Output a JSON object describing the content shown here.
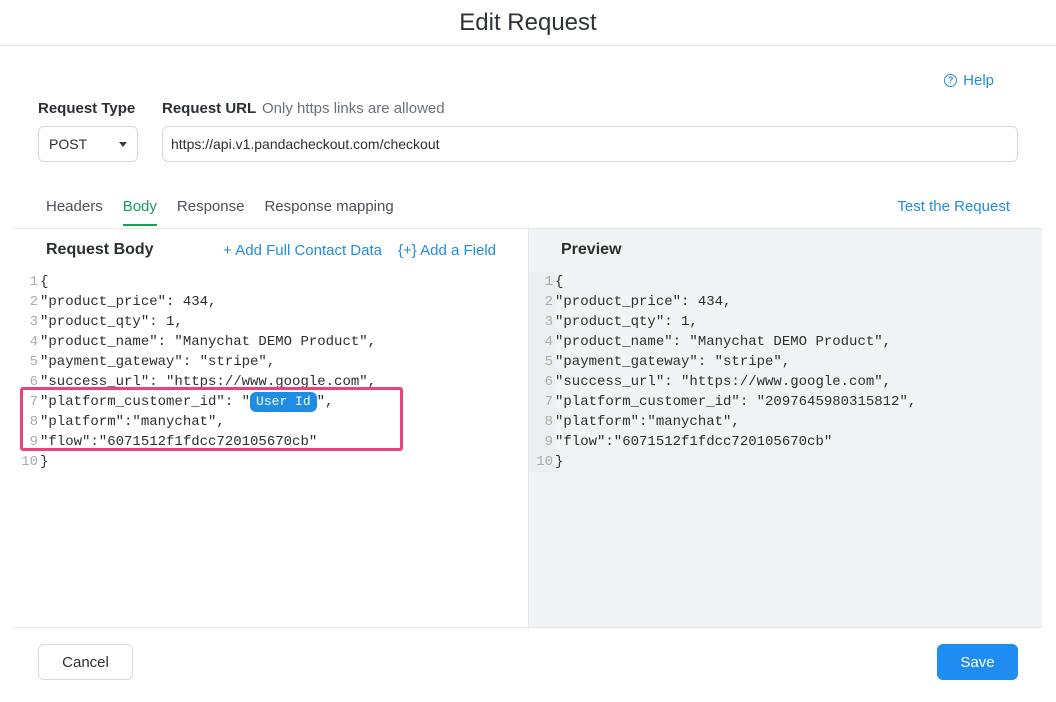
{
  "header": {
    "title": "Edit Request"
  },
  "help": {
    "label": "Help",
    "icon": "question-circle-icon"
  },
  "request_type": {
    "label": "Request Type",
    "value": "POST"
  },
  "request_url": {
    "label": "Request URL",
    "hint": "Only https links are allowed",
    "value": "https://api.v1.pandacheckout.com/checkout"
  },
  "tabs": [
    {
      "label": "Headers",
      "active": false
    },
    {
      "label": "Body",
      "active": true
    },
    {
      "label": "Response",
      "active": false
    },
    {
      "label": "Response mapping",
      "active": false
    }
  ],
  "test_request": {
    "label": "Test the Request"
  },
  "request_body": {
    "title": "Request Body",
    "add_contact": "+ Add Full Contact Data",
    "add_field": "{+} Add a Field",
    "lines": [
      {
        "n": "1",
        "text": "{"
      },
      {
        "n": "2",
        "text": "\"product_price\": 434,"
      },
      {
        "n": "3",
        "text": "\"product_qty\": 1,"
      },
      {
        "n": "4",
        "text": "\"product_name\": \"Manychat DEMO Product\","
      },
      {
        "n": "5",
        "text": "\"payment_gateway\": \"stripe\","
      },
      {
        "n": "6",
        "text": "\"success_url\": \"https://www.google.com\","
      },
      {
        "n": "7",
        "text": "\"platform_customer_id\": \"",
        "chip": "User Id",
        "after": "\","
      },
      {
        "n": "8",
        "text": "\"platform\":\"manychat\","
      },
      {
        "n": "9",
        "text": "\"flow\":\"6071512f1fdcc720105670cb\""
      },
      {
        "n": "10",
        "text": "}"
      }
    ]
  },
  "preview": {
    "title": "Preview",
    "lines": [
      {
        "n": "1",
        "text": "{"
      },
      {
        "n": "2",
        "text": "\"product_price\": 434,"
      },
      {
        "n": "3",
        "text": "\"product_qty\": 1,"
      },
      {
        "n": "4",
        "text": "\"product_name\": \"Manychat DEMO Product\","
      },
      {
        "n": "5",
        "text": "\"payment_gateway\": \"stripe\","
      },
      {
        "n": "6",
        "text": "\"success_url\": \"https://www.google.com\","
      },
      {
        "n": "7",
        "text": "\"platform_customer_id\": \"2097645980315812\","
      },
      {
        "n": "8",
        "text": "\"platform\":\"manychat\","
      },
      {
        "n": "9",
        "text": "\"flow\":\"6071512f1fdcc720105670cb\""
      },
      {
        "n": "10",
        "text": "}"
      }
    ]
  },
  "footer": {
    "cancel_label": "Cancel",
    "save_label": "Save"
  },
  "colors": {
    "accent": "#1e8cf0",
    "active_tab": "#15a05a",
    "highlight": "#e8437a"
  }
}
